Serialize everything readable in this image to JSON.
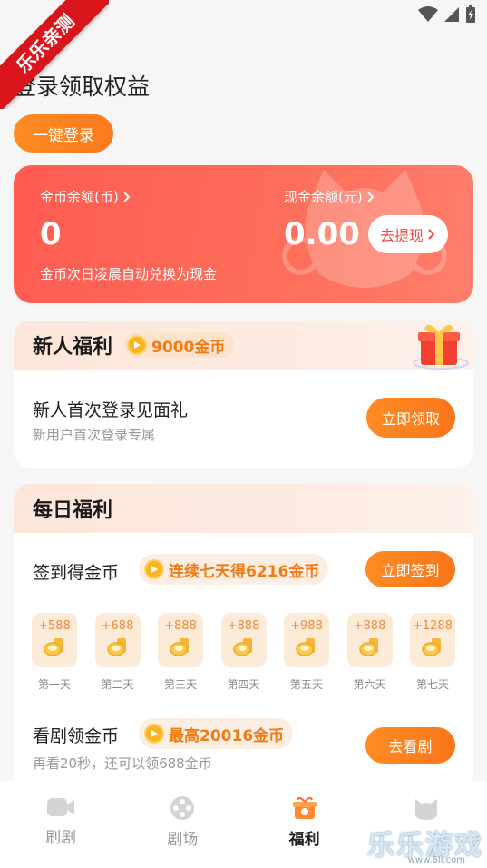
{
  "watermark_ribbon": "乐乐亲测",
  "page_title": "登录领取权益",
  "login_button": "一键登录",
  "balance": {
    "coin_label": "金币余额(币)",
    "coin_value": "0",
    "cash_label": "现金余额(元)",
    "cash_value": "0.00",
    "note": "金币次日凌晨自动兑换为现金",
    "withdraw_button": "去提现"
  },
  "newbie": {
    "title": "新人福利",
    "coins": "9000金币",
    "row_title": "新人首次登录见面礼",
    "row_sub": "新用户首次登录专属",
    "button": "立即领取"
  },
  "daily": {
    "title": "每日福利",
    "signin_title": "签到得金币",
    "signin_hint": "连续七天得6216金币",
    "signin_button": "立即签到",
    "days": [
      {
        "amount": "+588",
        "label": "第一天"
      },
      {
        "amount": "+688",
        "label": "第二天"
      },
      {
        "amount": "+888",
        "label": "第三天"
      },
      {
        "amount": "+888",
        "label": "第四天"
      },
      {
        "amount": "+988",
        "label": "第五天"
      },
      {
        "amount": "+888",
        "label": "第六天"
      },
      {
        "amount": "+1288",
        "label": "第七天"
      }
    ],
    "watch_title": "看剧领金币",
    "watch_hint": "最高20016金币",
    "watch_sub": "再看20秒，还可以领688金币",
    "watch_button": "去看剧"
  },
  "tabs": [
    {
      "label": "刷剧",
      "icon": "video-icon"
    },
    {
      "label": "剧场",
      "icon": "film-reel-icon"
    },
    {
      "label": "福利",
      "icon": "gift-box-icon",
      "active": true
    },
    {
      "label": "",
      "icon": "cat-face-icon"
    }
  ],
  "corner_watermark": "乐乐游戏",
  "corner_watermark_url": "www.6ll.com",
  "colors": {
    "accent_orange": "#fb7a1d",
    "card_red": "#ff5b52",
    "coin_gold": "#fbb321"
  }
}
